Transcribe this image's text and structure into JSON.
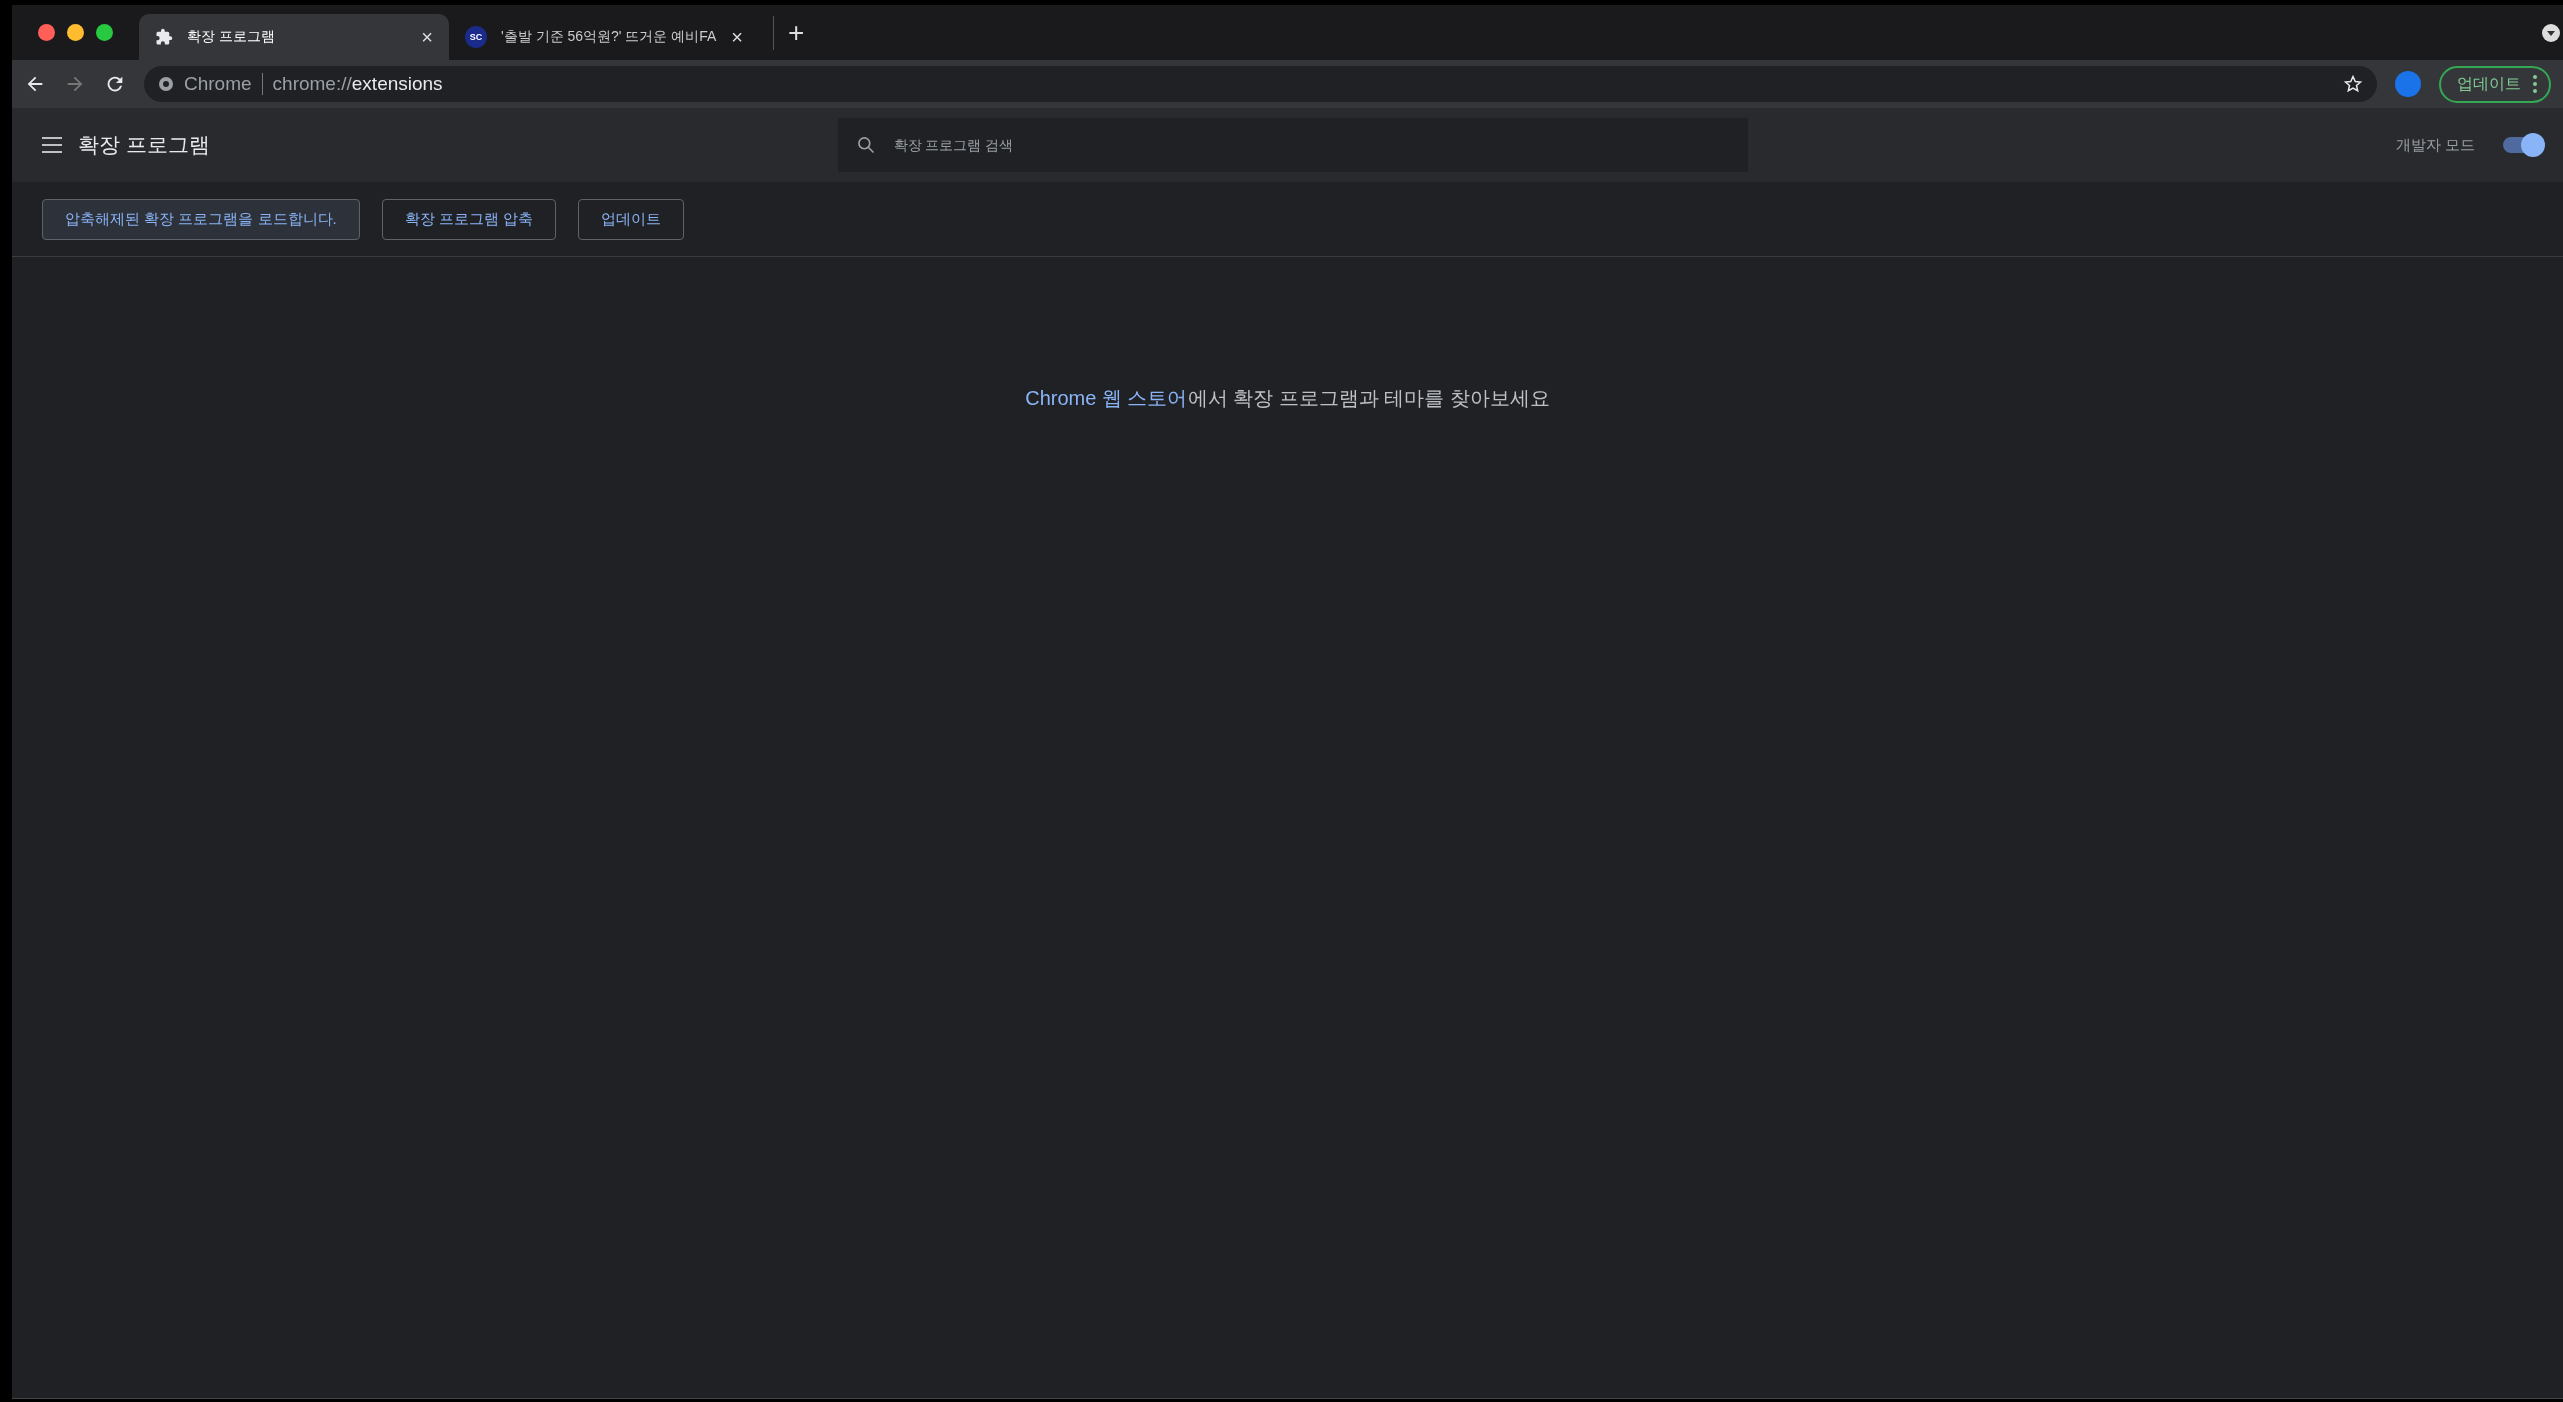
{
  "tabs": [
    {
      "title": "확장 프로그램",
      "kind": "extensions",
      "close": "×",
      "selected": true
    },
    {
      "title": "'출발 기준 56억원?' 뜨거운 예비FA",
      "kind": "site",
      "favicon_text": "SC",
      "close": "×",
      "selected": false
    }
  ],
  "new_tab": "+",
  "address_bar": {
    "site_label": "Chrome",
    "url_prefix": "chrome://",
    "url_path": "extensions"
  },
  "update_button": "업데이트",
  "header": {
    "title": "확장 프로그램",
    "search": {
      "placeholder": "확장 프로그램 검색"
    },
    "developer_mode": {
      "label": "개발자 모드",
      "on": true
    }
  },
  "actions": [
    {
      "label": "압축해제된 확장 프로그램을 로드합니다.",
      "hovered": true
    },
    {
      "label": "확장 프로그램 압축",
      "hovered": false
    },
    {
      "label": "업데이트",
      "hovered": false
    }
  ],
  "message": {
    "link": "Chrome 웹 스토어",
    "text": "에서 확장 프로그램과 테마를 찾아보세요"
  }
}
